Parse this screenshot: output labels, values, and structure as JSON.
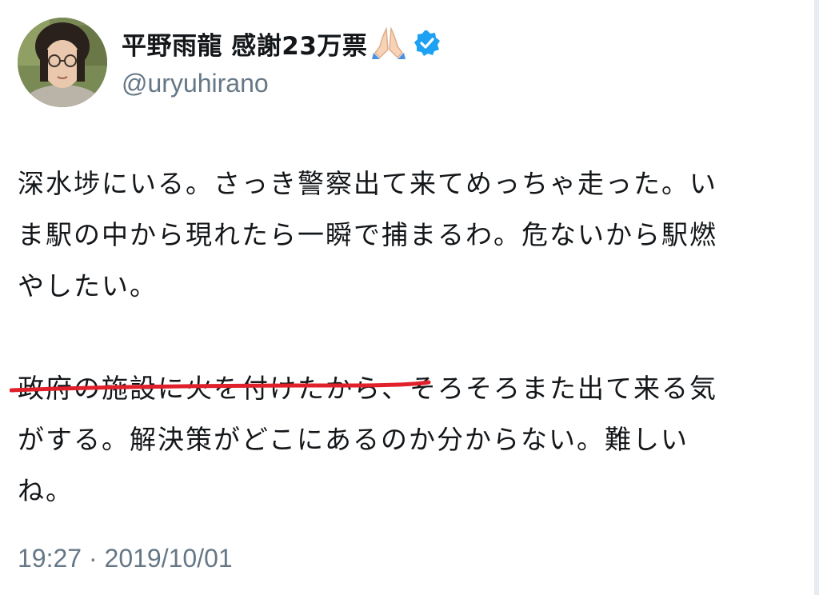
{
  "author": {
    "display_name": "平野雨龍 感謝23万票",
    "emoji": "folded-hands-emoji",
    "verified": true,
    "handle": "@uryuhirano"
  },
  "tweet": {
    "paragraph1": {
      "line1": "深水埗にいる。さっき警察出て来てめっちゃ走った。い",
      "line2": "ま駅の中から現れたら一瞬で捕まるわ。危ないから駅燃",
      "line3": "やしたい。"
    },
    "paragraph2": {
      "line1": "政府の施設に火を付けたから、そろそろまた出て来る気",
      "line2": "がする。解決策がどこにあるのか分からない。難しい",
      "line3": "ね。"
    },
    "timestamp": "19:27 · 2019/10/01"
  },
  "colors": {
    "text": "#14171a",
    "secondary_text": "#657786",
    "verified_badge": "#1da1f2",
    "underline_annotation": "#e0202a"
  }
}
